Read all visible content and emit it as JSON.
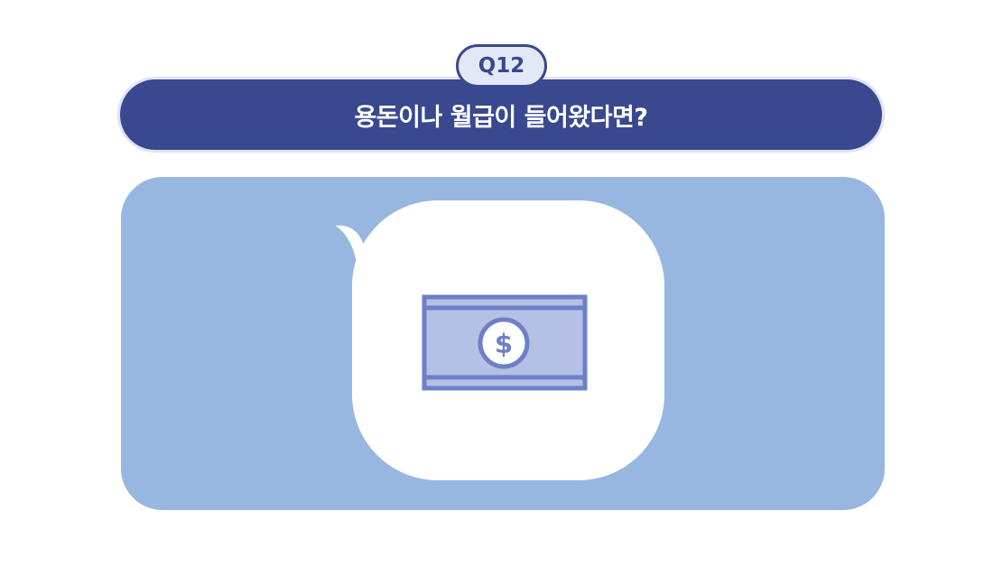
{
  "question": {
    "number": "Q12",
    "text": "용돈이나 월급이 들어왔다면?"
  },
  "illustration": {
    "icon": "dollar-bill-icon",
    "symbol": "$"
  },
  "colors": {
    "banner": "#39488f",
    "badge_fill": "#e3e8f7",
    "panel": "#97b7e0",
    "bubble": "#ffffff",
    "bill_fill": "#b4c0e6",
    "bill_stroke": "#6d80c7"
  }
}
